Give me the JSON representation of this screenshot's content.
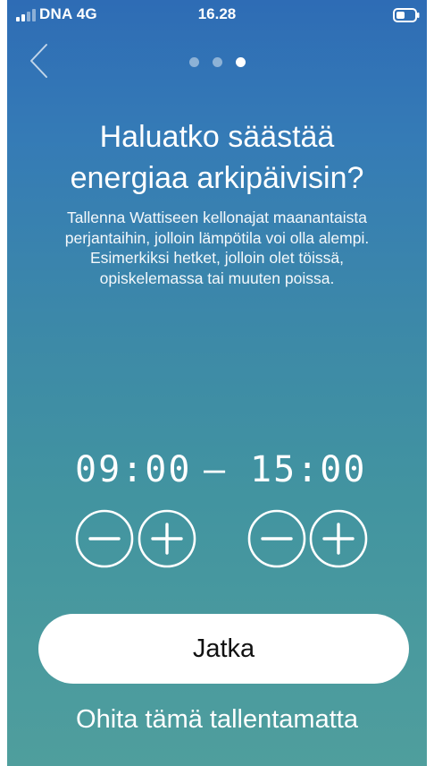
{
  "status_bar": {
    "carrier": "DNA 4G",
    "time": "16.28"
  },
  "pager": {
    "total": 3,
    "active": 3
  },
  "title": {
    "line1": "Haluatko säästää",
    "line2": "energiaa arkipäivisin?"
  },
  "description": {
    "line1": "Tallenna Wattiseen kellonajat maanantaista",
    "line2": "perjantaihin, jolloin lämpötila voi olla alempi.",
    "line3": "Esimerkiksi hetket, jolloin olet töissä,",
    "line4": "opiskelemassa tai muuten poissa."
  },
  "schedule": {
    "start_time": "09:00",
    "separator": "—",
    "end_time": "15:00"
  },
  "icons": {
    "back": "chevron-left-icon",
    "decrement": "minus-circle-icon",
    "increment": "plus-circle-icon",
    "signal": "signal-icon",
    "battery": "battery-icon"
  },
  "actions": {
    "continue_label": "Jatka",
    "skip_label": "Ohita tämä tallentamatta"
  },
  "colors": {
    "gradient_top": "#2e6cb5",
    "gradient_bottom": "#4f9e9d",
    "button_bg": "#ffffff",
    "button_text": "#111111"
  }
}
